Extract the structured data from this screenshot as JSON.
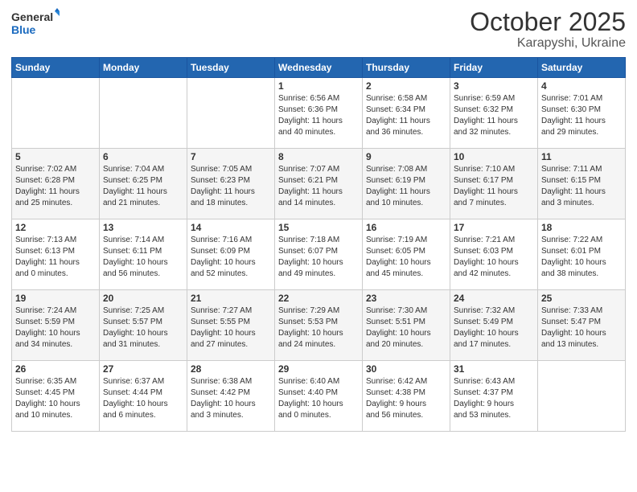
{
  "header": {
    "logo_general": "General",
    "logo_blue": "Blue",
    "title": "October 2025",
    "subtitle": "Karapyshi, Ukraine"
  },
  "days_of_week": [
    "Sunday",
    "Monday",
    "Tuesday",
    "Wednesday",
    "Thursday",
    "Friday",
    "Saturday"
  ],
  "weeks": [
    [
      {
        "day": "",
        "info": ""
      },
      {
        "day": "",
        "info": ""
      },
      {
        "day": "",
        "info": ""
      },
      {
        "day": "1",
        "info": "Sunrise: 6:56 AM\nSunset: 6:36 PM\nDaylight: 11 hours\nand 40 minutes."
      },
      {
        "day": "2",
        "info": "Sunrise: 6:58 AM\nSunset: 6:34 PM\nDaylight: 11 hours\nand 36 minutes."
      },
      {
        "day": "3",
        "info": "Sunrise: 6:59 AM\nSunset: 6:32 PM\nDaylight: 11 hours\nand 32 minutes."
      },
      {
        "day": "4",
        "info": "Sunrise: 7:01 AM\nSunset: 6:30 PM\nDaylight: 11 hours\nand 29 minutes."
      }
    ],
    [
      {
        "day": "5",
        "info": "Sunrise: 7:02 AM\nSunset: 6:28 PM\nDaylight: 11 hours\nand 25 minutes."
      },
      {
        "day": "6",
        "info": "Sunrise: 7:04 AM\nSunset: 6:25 PM\nDaylight: 11 hours\nand 21 minutes."
      },
      {
        "day": "7",
        "info": "Sunrise: 7:05 AM\nSunset: 6:23 PM\nDaylight: 11 hours\nand 18 minutes."
      },
      {
        "day": "8",
        "info": "Sunrise: 7:07 AM\nSunset: 6:21 PM\nDaylight: 11 hours\nand 14 minutes."
      },
      {
        "day": "9",
        "info": "Sunrise: 7:08 AM\nSunset: 6:19 PM\nDaylight: 11 hours\nand 10 minutes."
      },
      {
        "day": "10",
        "info": "Sunrise: 7:10 AM\nSunset: 6:17 PM\nDaylight: 11 hours\nand 7 minutes."
      },
      {
        "day": "11",
        "info": "Sunrise: 7:11 AM\nSunset: 6:15 PM\nDaylight: 11 hours\nand 3 minutes."
      }
    ],
    [
      {
        "day": "12",
        "info": "Sunrise: 7:13 AM\nSunset: 6:13 PM\nDaylight: 11 hours\nand 0 minutes."
      },
      {
        "day": "13",
        "info": "Sunrise: 7:14 AM\nSunset: 6:11 PM\nDaylight: 10 hours\nand 56 minutes."
      },
      {
        "day": "14",
        "info": "Sunrise: 7:16 AM\nSunset: 6:09 PM\nDaylight: 10 hours\nand 52 minutes."
      },
      {
        "day": "15",
        "info": "Sunrise: 7:18 AM\nSunset: 6:07 PM\nDaylight: 10 hours\nand 49 minutes."
      },
      {
        "day": "16",
        "info": "Sunrise: 7:19 AM\nSunset: 6:05 PM\nDaylight: 10 hours\nand 45 minutes."
      },
      {
        "day": "17",
        "info": "Sunrise: 7:21 AM\nSunset: 6:03 PM\nDaylight: 10 hours\nand 42 minutes."
      },
      {
        "day": "18",
        "info": "Sunrise: 7:22 AM\nSunset: 6:01 PM\nDaylight: 10 hours\nand 38 minutes."
      }
    ],
    [
      {
        "day": "19",
        "info": "Sunrise: 7:24 AM\nSunset: 5:59 PM\nDaylight: 10 hours\nand 34 minutes."
      },
      {
        "day": "20",
        "info": "Sunrise: 7:25 AM\nSunset: 5:57 PM\nDaylight: 10 hours\nand 31 minutes."
      },
      {
        "day": "21",
        "info": "Sunrise: 7:27 AM\nSunset: 5:55 PM\nDaylight: 10 hours\nand 27 minutes."
      },
      {
        "day": "22",
        "info": "Sunrise: 7:29 AM\nSunset: 5:53 PM\nDaylight: 10 hours\nand 24 minutes."
      },
      {
        "day": "23",
        "info": "Sunrise: 7:30 AM\nSunset: 5:51 PM\nDaylight: 10 hours\nand 20 minutes."
      },
      {
        "day": "24",
        "info": "Sunrise: 7:32 AM\nSunset: 5:49 PM\nDaylight: 10 hours\nand 17 minutes."
      },
      {
        "day": "25",
        "info": "Sunrise: 7:33 AM\nSunset: 5:47 PM\nDaylight: 10 hours\nand 13 minutes."
      }
    ],
    [
      {
        "day": "26",
        "info": "Sunrise: 6:35 AM\nSunset: 4:45 PM\nDaylight: 10 hours\nand 10 minutes."
      },
      {
        "day": "27",
        "info": "Sunrise: 6:37 AM\nSunset: 4:44 PM\nDaylight: 10 hours\nand 6 minutes."
      },
      {
        "day": "28",
        "info": "Sunrise: 6:38 AM\nSunset: 4:42 PM\nDaylight: 10 hours\nand 3 minutes."
      },
      {
        "day": "29",
        "info": "Sunrise: 6:40 AM\nSunset: 4:40 PM\nDaylight: 10 hours\nand 0 minutes."
      },
      {
        "day": "30",
        "info": "Sunrise: 6:42 AM\nSunset: 4:38 PM\nDaylight: 9 hours\nand 56 minutes."
      },
      {
        "day": "31",
        "info": "Sunrise: 6:43 AM\nSunset: 4:37 PM\nDaylight: 9 hours\nand 53 minutes."
      },
      {
        "day": "",
        "info": ""
      }
    ]
  ]
}
